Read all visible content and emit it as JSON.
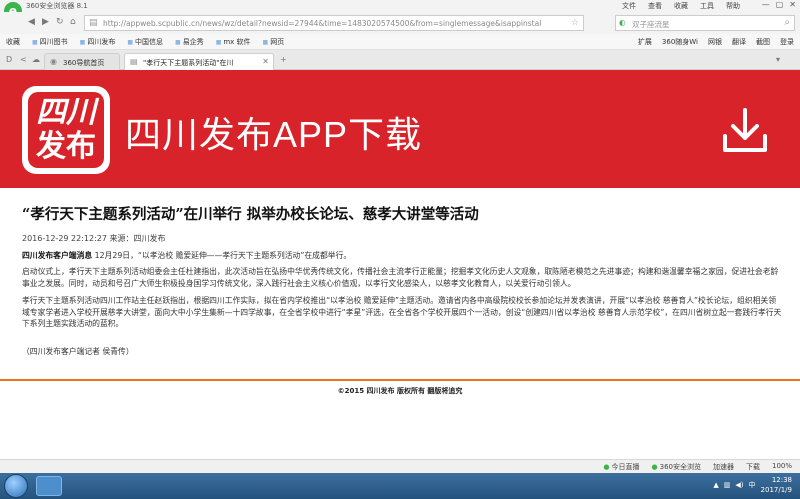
{
  "browser": {
    "app_title": "360安全浏览器 8.1",
    "menu": [
      "文件",
      "查看",
      "收藏",
      "工具",
      "帮助"
    ],
    "url": "http://appweb.scpublic.cn/news/wz/detail?newsid=27944&time=1483020574500&from=singlemessage&isappinstal",
    "search_placeholder": "双子座流星",
    "favorites": [
      "收藏",
      "四川图书",
      "四川发布",
      "中国信息",
      "易企秀",
      "mx 软件",
      "网页"
    ],
    "tools": [
      "扩展",
      "360随身Wi",
      "网银",
      "翻译",
      "截图",
      "登录"
    ],
    "tabs": [
      {
        "label": "360导航首页"
      },
      {
        "label": "\"孝行天下主题系列活动\"在川"
      }
    ],
    "status_items": [
      "今日直播",
      "360安全浏览",
      "加速器",
      "下载",
      "100%"
    ]
  },
  "page": {
    "banner": {
      "logo_line1": "四川",
      "logo_line2": "发布",
      "title": "四川发布APP下载",
      "brand_color": "#d8232a"
    },
    "article": {
      "title": "“孝行天下主题系列活动”在川举行  拟举办校长论坛、慈孝大讲堂等活动",
      "meta": "2016-12-29 22:12:27 来源：四川发布",
      "lead_bold": "四川发布客户端消息",
      "p1_rest": "  12月29日，“以孝治校 赡爱延伸——孝行天下主题系列活动”在成都举行。",
      "p2": "启动仪式上，孝行天下主题系列活动组委会主任杜建指出，此次活动旨在弘扬中华优秀传统文化，传播社会主流孝行正能量；挖掘孝文化历史人文观象，取陈陋老模范之先进事迹；构建和谐温馨幸福之家园，促进社会老龄事业之发展。同时，动员和号召广大师生积极投身国学习传统文化，深入践行社会主义核心价值观，以孝行文化感染人，以慈孝文化教育人，以关爱行动引领人。",
      "p3": "孝行天下主题系列活动四川工作站主任赵跃指出，根据四川工作实际，拟在省内学校推出“以孝治校 赡爱延伸”主题活动。邀请省内各中高级院校校长参加论坛并发表演讲，开展“以孝治校 慈善育人”校长论坛，组织相关领域专家学者进入学校开展慈孝大讲堂，面向大中小学生集新—十四学故事，在全省学校中进行“孝星”评选，在全省各个学校开展四个一活动，创设“创建四川省以孝治校 慈善育人示范学校”，在四川省树立起一套践行孝行天下系列主题实践活动的蓝积。",
      "reporter": "（四川发布客户端记者  侯青传）"
    },
    "copyright": "©2015 四川发布  版权所有  翻版将追究",
    "accent_color": "#e8731c"
  },
  "taskbar": {
    "time": "12:38",
    "date": "2017/1/9"
  }
}
